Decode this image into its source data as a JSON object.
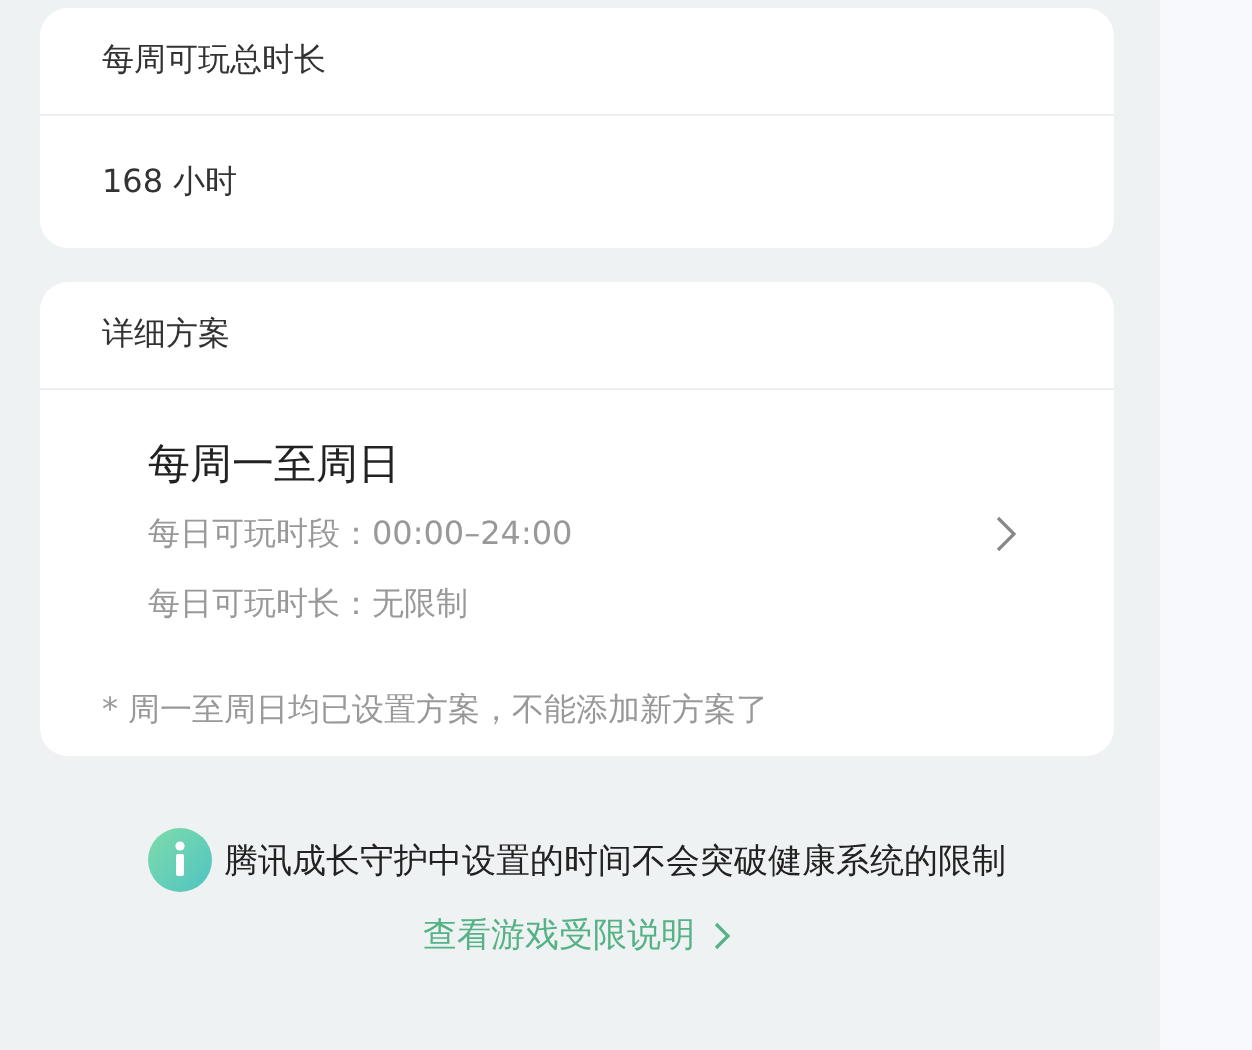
{
  "weekly_total": {
    "title": "每周可玩总时长",
    "value": "168 小时"
  },
  "detail_plan": {
    "title": "详细方案",
    "plans": [
      {
        "days": "每周一至周日",
        "period": "每日可玩时段：00:00–24:00",
        "duration": "每日可玩时长：无限制"
      }
    ],
    "note": "* 周一至周日均已设置方案，不能添加新方案了"
  },
  "info": {
    "text": "腾讯成长守护中设置的时间不会突破健康系统的限制",
    "link": "查看游戏受限说明"
  }
}
